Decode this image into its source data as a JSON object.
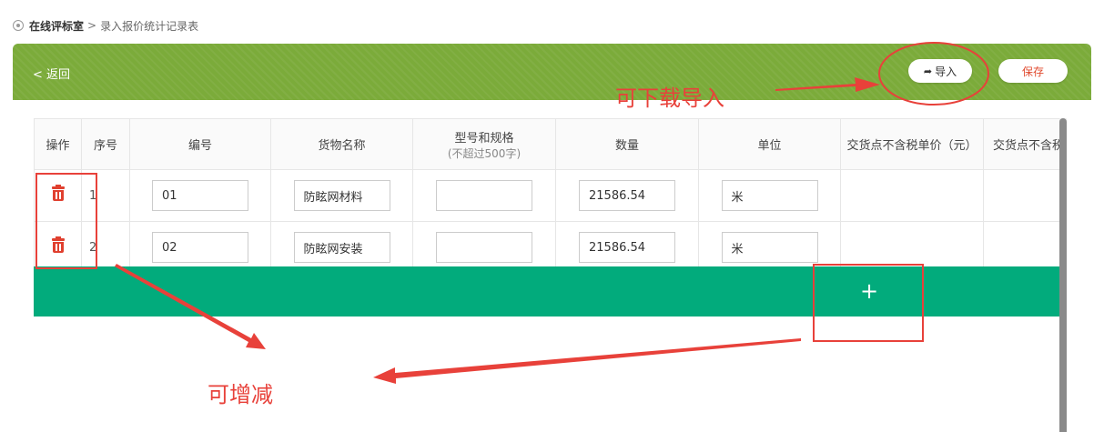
{
  "breadcrumb": {
    "root": "在线评标室",
    "separator": ">",
    "current": "录入报价统计记录表"
  },
  "header": {
    "back_label": "< 返回",
    "import_label": "导入",
    "save_label": "保存"
  },
  "table": {
    "columns": [
      {
        "label": "操作"
      },
      {
        "label": "序号"
      },
      {
        "label": "编号"
      },
      {
        "label": "货物名称"
      },
      {
        "label": "型号和规格",
        "sub": "(不超过500字)"
      },
      {
        "label": "数量"
      },
      {
        "label": "单位"
      },
      {
        "label": "交货点不含税单价（元）"
      },
      {
        "label": "交货点不含税"
      }
    ],
    "rows": [
      {
        "seq": "1",
        "code": "01",
        "name": "防眩网材料",
        "spec": "",
        "qty": "21586.54",
        "unit": "米"
      },
      {
        "seq": "2",
        "code": "02",
        "name": "防眩网安装",
        "spec": "",
        "qty": "21586.54",
        "unit": "米"
      }
    ],
    "add_button": "+"
  },
  "annotations": {
    "download_import": "可下载导入",
    "add_remove": "可增减",
    "color": "#e8413a"
  },
  "colors": {
    "header_green": "#7bab3a",
    "add_bar_green": "#02ab7c",
    "delete_red": "#e0402f"
  }
}
